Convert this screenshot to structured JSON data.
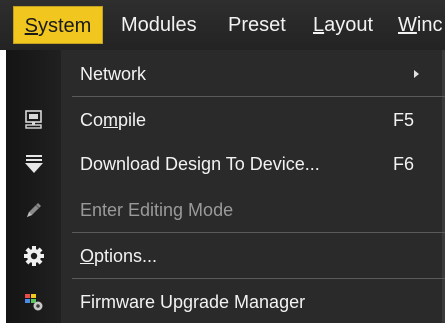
{
  "menubar": {
    "items": [
      {
        "pre": "",
        "ul": "S",
        "post": "ystem"
      },
      {
        "pre": "Modules",
        "ul": "",
        "post": ""
      },
      {
        "pre": "Preset",
        "ul": "",
        "post": ""
      },
      {
        "pre": "",
        "ul": "L",
        "post": "ayout"
      },
      {
        "pre": "",
        "ul": "W",
        "post": "inc"
      }
    ]
  },
  "dropdown": {
    "network": {
      "label": "Network",
      "icon": "none",
      "submenu": true
    },
    "compile": {
      "pre": "Co",
      "ul": "m",
      "post": "pile",
      "shortcut": "F5",
      "icon": "computer-icon"
    },
    "download": {
      "label": "Download Design To Device...",
      "shortcut": "F6",
      "icon": "download-icon"
    },
    "editing": {
      "label": "Enter Editing Mode",
      "icon": "pencil-icon",
      "disabled": true
    },
    "options": {
      "pre": "",
      "ul": "O",
      "post": "ptions...",
      "icon": "gear-icon"
    },
    "firmware": {
      "label": "Firmware Upgrade Manager",
      "icon": "firmware-icon"
    }
  },
  "colors": {
    "menubar_bg": "#2a2a2a",
    "active_menu": "#f0c61f",
    "dropdown_bg": "#2a2a2a",
    "text": "#f2f2f2",
    "disabled_text": "#9a9a9a"
  }
}
